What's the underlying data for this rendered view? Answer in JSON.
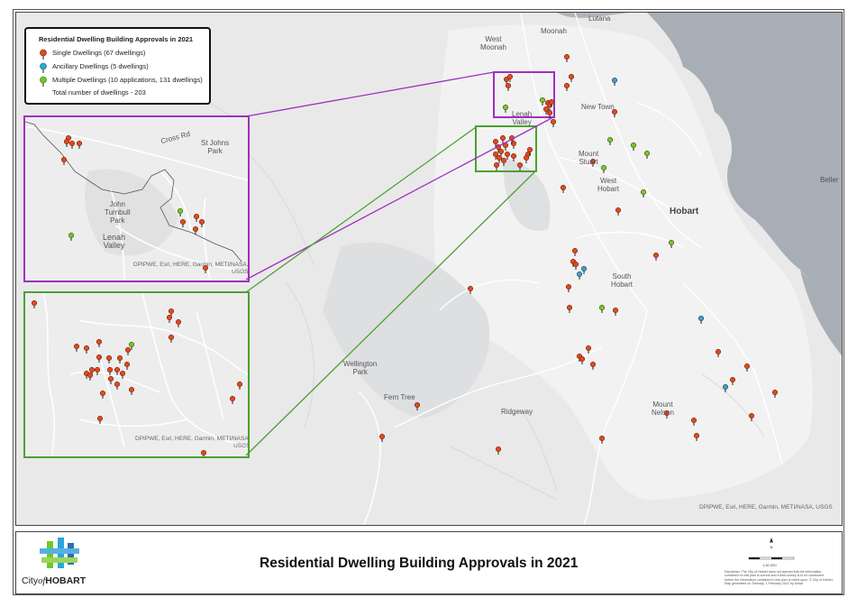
{
  "legend": {
    "title": "Residential Dwelling Building Approvals in 2021",
    "single": "Single Dwellings (67 dwellings)",
    "ancillary": "Ancillary Dwellings (5 dwellings)",
    "multiple": "Multiple Dwellings (10 applications, 131 dwellings)",
    "total": "Total number of dwellings - 203"
  },
  "colors": {
    "single": "#e04a1f",
    "ancillary": "#2aa7d6",
    "multiple": "#6ccb2a",
    "inset_purple": "#a12fc0",
    "inset_green": "#4aa22f",
    "water": "#a8aeb5"
  },
  "map_labels": {
    "lutana": "Lutana",
    "moonah": "Moonah",
    "west_moonah": "West\nMoonah",
    "new_town": "New Town",
    "lenah_valley": "Lenah\nValley",
    "mount_stuart": "Mount\nStuart",
    "west_hobart": "West\nHobart",
    "hobart": "Hobart",
    "bellerive": "Beller",
    "south_hobart": "South\nHobart",
    "wellington_park": "Wellington\nPark",
    "fern_tree": "Fern Tree",
    "ridgeway": "Ridgeway",
    "mount_nelson": "Mount\nNelson"
  },
  "inset_labels": {
    "cross_rd": "Cross Rd",
    "st_johns_park": "St Johns\nPark",
    "john_turnbull_park": "John\nTurnbull\nPark",
    "lenah_valley": "Lenah\nValley"
  },
  "attribution": {
    "main": "DPIPWE, Esri, HERE, Garmin, METI/NASA, USGS",
    "inset_purple": "DPIPWE, Esri, HERE, Garmin, METI/NASA,\nUSGS",
    "inset_green": "DPIPWE, Esri, HERE, Garmin, METI/NASA,\nUSGS"
  },
  "footer": {
    "title": "Residential Dwelling Building Approvals in 2021",
    "logo_prefix": "City",
    "logo_of": "of",
    "logo_suffix": "HOBART",
    "disclaimer": "Disclaimer: The City of Hobart does not warrant that the information contained on this plan is correct and a field survey is to be conducted before the information contained in this plan is relied upon. © City of Hobart Map generated on Tuesday, 1 February 2022 by Ahdat",
    "scale": "1:40,000",
    "north": "N"
  }
}
